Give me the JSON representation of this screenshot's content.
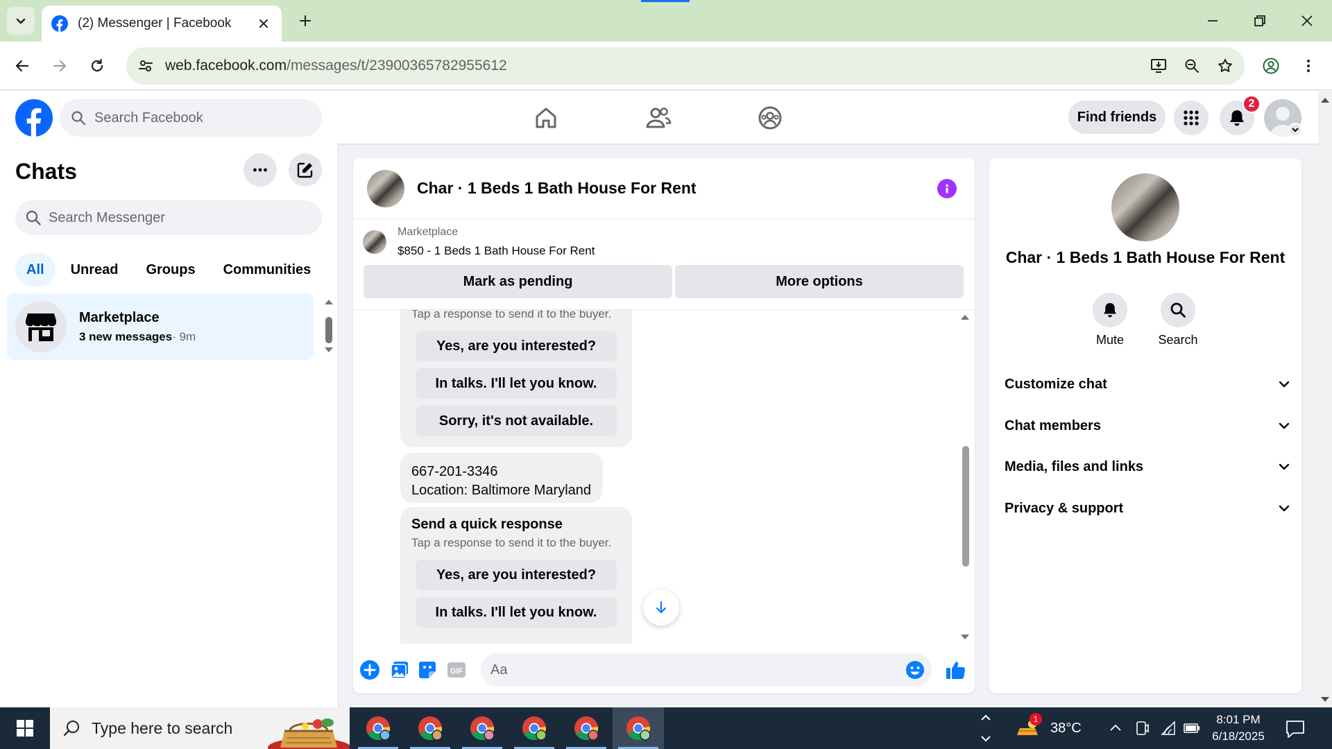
{
  "browser": {
    "tab_title": "(2) Messenger | Facebook",
    "url_host": "web.facebook.com",
    "url_path": "/messages/t/23900365782955612"
  },
  "header": {
    "search_placeholder": "Search Facebook",
    "find_friends_label": "Find friends",
    "notification_count": "2"
  },
  "sidebar": {
    "title": "Chats",
    "search_placeholder": "Search Messenger",
    "filters": [
      "All",
      "Unread",
      "Groups",
      "Communities"
    ],
    "active_filter": "All",
    "chats": [
      {
        "name": "Marketplace",
        "preview": "3 new messages",
        "time": "· 9m"
      }
    ]
  },
  "conversation": {
    "title": "Char · 1 Beds 1 Bath House For Rent",
    "marketplace_label": "Marketplace",
    "listing": "$850 - 1 Beds 1 Bath House For Rent",
    "mark_pending_label": "Mark as pending",
    "more_options_label": "More options",
    "messages": [
      {
        "hint": "Tap a response to send it to the buyer.",
        "responses": [
          "Yes, are you interested?",
          "In talks. I'll let you know.",
          "Sorry, it's not available."
        ]
      },
      {
        "lines": [
          "667-201-3346",
          "Location: Baltimore Maryland"
        ]
      },
      {
        "heading": "Send a quick response",
        "hint": "Tap a response to send it to the buyer.",
        "responses": [
          "Yes, are you interested?",
          "In talks. I'll let you know."
        ]
      }
    ],
    "composer_placeholder": "Aa"
  },
  "details": {
    "name": "Char · 1 Beds 1 Bath House For Rent",
    "actions": [
      "Mute",
      "Search"
    ],
    "sections": [
      "Customize chat",
      "Chat members",
      "Media, files and links",
      "Privacy & support"
    ]
  },
  "taskbar": {
    "search_placeholder": "Type here to search",
    "weather_badge": "1",
    "temperature": "38°C",
    "time": "8:01 PM",
    "date": "6/18/2025"
  },
  "colors": {
    "fb_blue": "#0866ff",
    "messenger_blue": "#0a7cff",
    "info_purple": "#a033ff",
    "badge_red": "#e41e3f",
    "tabbar_green": "#cfe6c6"
  }
}
